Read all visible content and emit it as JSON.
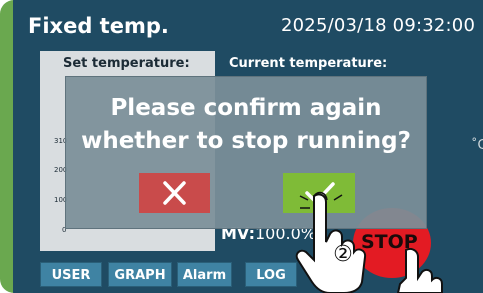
{
  "header": {
    "title": "Fixed temp.",
    "datetime": "2025/03/18  09:32:00"
  },
  "panels": {
    "set_label": "Set temperature:",
    "current_label": "Current temperature:"
  },
  "axis_ticks": [
    "310",
    "200",
    "100",
    "0"
  ],
  "unit_symbol": "˚C",
  "mv": {
    "label": "MV:",
    "value": "100.0%"
  },
  "stop_button": {
    "label": "STOP",
    "color": "#e31b23"
  },
  "dialog": {
    "line1": "Please confirm again",
    "line2": "whether to stop running?",
    "cancel_icon": "close-icon",
    "confirm_icon": "check-icon",
    "cancel_color": "#c94b4b",
    "confirm_color": "#7fbb37"
  },
  "annotation": {
    "step_marker": "②"
  },
  "tabs": [
    "USER",
    "GRAPH",
    "Alarm",
    "LOG"
  ],
  "colors": {
    "screen_bg": "#1f4b63",
    "tab_bg": "#3f83a3",
    "bezel": "#6aa84f"
  }
}
